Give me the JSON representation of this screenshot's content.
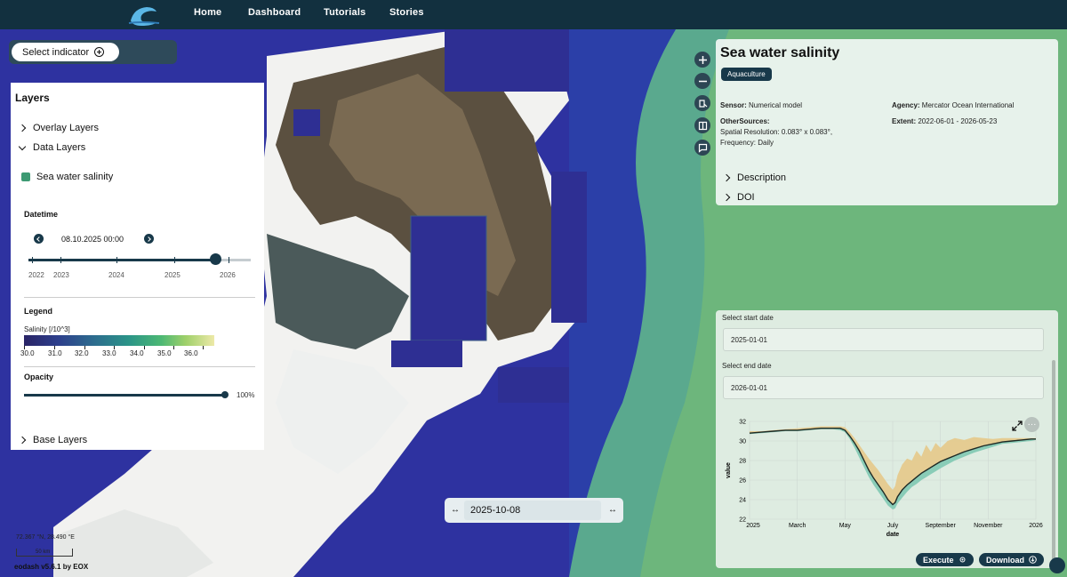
{
  "nav": {
    "links": [
      "Home",
      "Dashboard",
      "Tutorials",
      "Stories"
    ]
  },
  "left_panel": {
    "select_indicator_label": "Select indicator",
    "layers_title": "Layers",
    "overlay_layers_label": "Overlay Layers",
    "data_layers_label": "Data Layers",
    "active_layer_label": "Sea water salinity",
    "base_layers_label": "Base Layers",
    "datetime_label": "Datetime",
    "datetime_value": "08.10.2025 00:00",
    "year_labels": [
      "2022",
      "2023",
      "2024",
      "2025",
      "2026"
    ],
    "time_slider_fraction": 0.84,
    "legend_label": "Legend",
    "legend_unit": "Salinity [/10^3]",
    "legend_values": [
      "30.0",
      "31.0",
      "32.0",
      "33.0",
      "34.0",
      "35.0",
      "36.0"
    ],
    "opacity_label": "Opacity",
    "opacity_value": "100%"
  },
  "info_panel": {
    "title": "Sea water salinity",
    "badge": "Aquaculture",
    "sensor_key": "Sensor:",
    "sensor_value": " Numerical model",
    "agency_key": "Agency:",
    "agency_value": " Mercator Ocean International",
    "other_sources_key": "OtherSources:",
    "other_sources_line1": "Spatial Resolution: 0.083° x 0.083°,",
    "other_sources_line2": "Frequency: Daily",
    "extent_key": "Extent:",
    "extent_value": " 2022-06-01 - 2026-05-23",
    "description_label": "Description",
    "doi_label": "DOI"
  },
  "process_panel": {
    "start_date_label": "Select start date",
    "start_date_value": "2025-01-01",
    "end_date_label": "Select end date",
    "end_date_value": "2026-01-01",
    "execute_label": "Execute",
    "download_label": "Download"
  },
  "chart_data": {
    "type": "line",
    "xlabel": "date",
    "ylabel": "value",
    "x_tick_labels": [
      "2025",
      "March",
      "May",
      "July",
      "September",
      "November",
      "2026"
    ],
    "x_tick_months": [
      0,
      2,
      4,
      6,
      8,
      10,
      12
    ],
    "ylim": [
      22,
      32
    ],
    "y_ticks": [
      22,
      24,
      26,
      28,
      30,
      32
    ],
    "grid": true,
    "series": [
      {
        "name": "",
        "color": "#1e2a26",
        "x_months": [
          0,
          0.5,
          1,
          1.5,
          2,
          2.5,
          3,
          3.5,
          3.8,
          4.0,
          4.2,
          4.4,
          4.6,
          4.8,
          5.0,
          5.2,
          5.4,
          5.6,
          5.8,
          6.0,
          6.1,
          6.2,
          6.4,
          6.6,
          6.8,
          7.0,
          7.2,
          7.4,
          7.6,
          7.8,
          8.0,
          8.3,
          8.6,
          9.0,
          9.4,
          9.8,
          10.2,
          10.6,
          11.0,
          11.4,
          11.8,
          12.0
        ],
        "values": [
          30.8,
          30.9,
          31.0,
          31.1,
          31.1,
          31.2,
          31.3,
          31.3,
          31.3,
          31.1,
          30.5,
          29.8,
          29.0,
          28.0,
          27.0,
          26.2,
          25.5,
          24.8,
          24.0,
          23.5,
          23.7,
          24.3,
          25.0,
          25.5,
          25.9,
          26.3,
          26.7,
          27.0,
          27.3,
          27.6,
          27.9,
          28.2,
          28.5,
          28.9,
          29.2,
          29.5,
          29.7,
          29.9,
          30.0,
          30.1,
          30.2,
          30.2
        ]
      }
    ],
    "band_upper_color": "#e6c98a",
    "band_lower_color": "#7fc9b2",
    "band_upper": [
      31.0,
      31.0,
      31.1,
      31.2,
      31.3,
      31.4,
      31.5,
      31.5,
      31.5,
      31.4,
      30.9,
      30.3,
      29.6,
      28.9,
      28.2,
      27.6,
      27.0,
      26.3,
      25.6,
      25.0,
      25.4,
      26.5,
      27.6,
      28.2,
      28.0,
      29.0,
      28.4,
      29.6,
      28.9,
      29.8,
      29.3,
      30.0,
      30.3,
      30.1,
      30.4,
      30.3,
      30.2,
      30.3,
      30.3,
      30.3,
      30.3,
      30.3
    ],
    "band_lower": [
      30.7,
      30.8,
      30.9,
      31.0,
      31.0,
      31.1,
      31.2,
      31.2,
      31.1,
      30.9,
      30.2,
      29.3,
      28.3,
      27.3,
      26.3,
      25.5,
      24.8,
      24.1,
      23.4,
      23.0,
      23.1,
      23.6,
      24.2,
      24.8,
      25.3,
      25.6,
      26.0,
      26.3,
      26.6,
      26.9,
      27.2,
      27.6,
      28.0,
      28.4,
      28.8,
      29.1,
      29.4,
      29.7,
      29.8,
      29.9,
      30.0,
      30.1
    ]
  },
  "map": {
    "date_value": "2025-10-08",
    "coords": "72.367 °N, 28.490 °E",
    "scale": "50 km",
    "version": "eodash v5.6.1 by EOX"
  },
  "colors": {
    "nav_bg": "#12303f",
    "accent": "#18394a",
    "layer_swatch": "#3d9a73"
  }
}
